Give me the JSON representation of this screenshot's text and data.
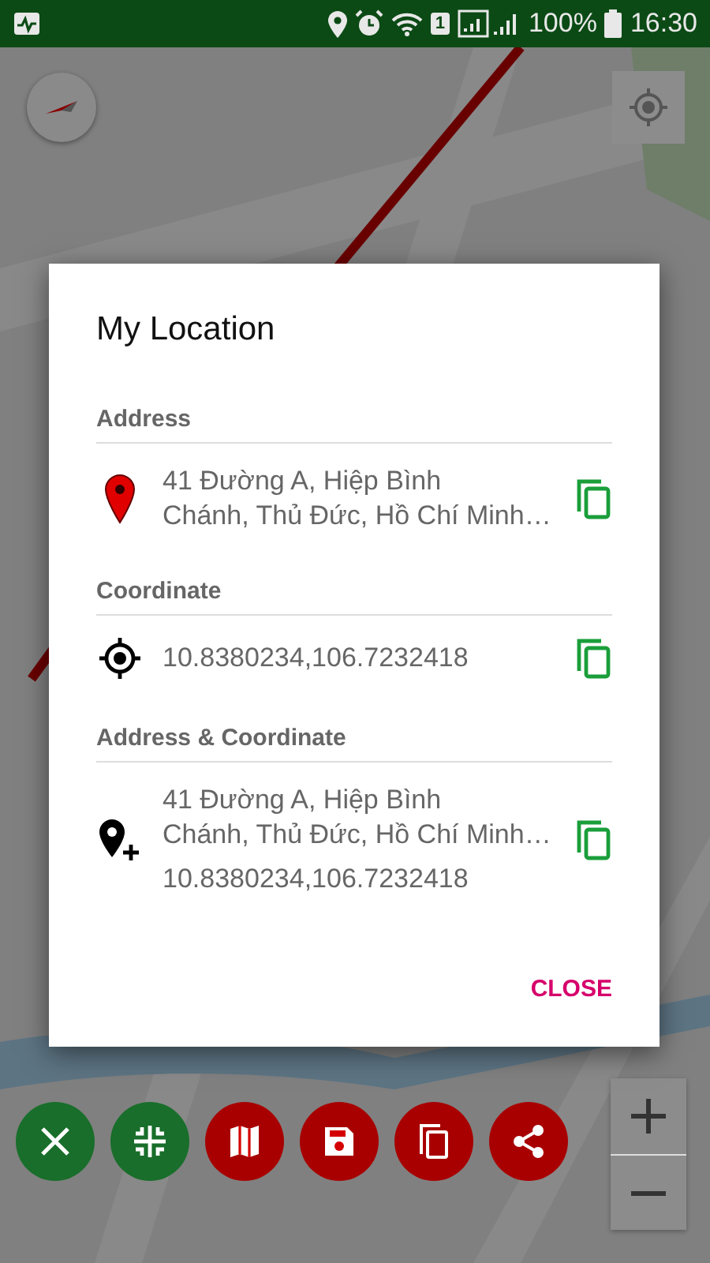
{
  "status_bar": {
    "sim_slot": "1",
    "battery": "100%",
    "time": "16:30"
  },
  "dialog": {
    "title": "My Location",
    "sections": [
      {
        "heading": "Address",
        "kind": "address",
        "lines": [
          "41 Đường A, Hiệp Bình",
          "Chánh, Thủ Đức, Hồ Chí Minh…"
        ]
      },
      {
        "heading": "Coordinate",
        "kind": "coordinate",
        "lines": [
          "10.8380234,106.7232418"
        ]
      },
      {
        "heading": "Address & Coordinate",
        "kind": "both",
        "lines": [
          "41 Đường A, Hiệp Bình",
          "Chánh, Thủ Đức, Hồ Chí Minh…"
        ],
        "extra": "10.8380234,106.7232418"
      }
    ],
    "button": "CLOSE"
  },
  "actions": [
    {
      "kind": "close",
      "color": "#186e2a"
    },
    {
      "kind": "collapse",
      "color": "#186e2a"
    },
    {
      "kind": "map",
      "color": "#a80000"
    },
    {
      "kind": "save",
      "color": "#a80000"
    },
    {
      "kind": "copy",
      "color": "#a80000"
    },
    {
      "kind": "share",
      "color": "#a80000"
    }
  ]
}
